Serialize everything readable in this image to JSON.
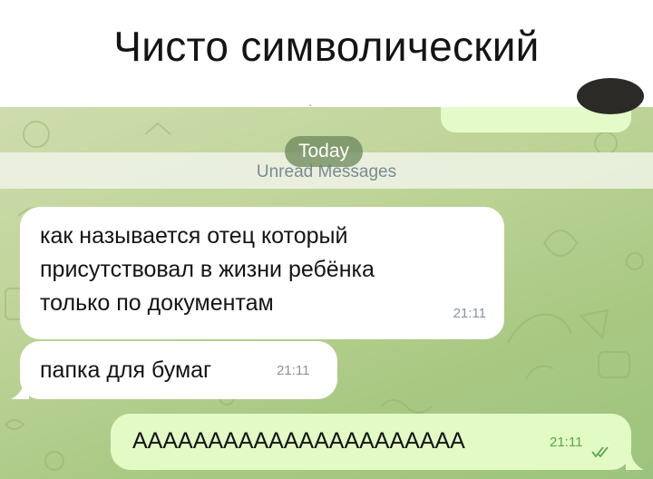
{
  "caption": {
    "text": "Чисто символический"
  },
  "header": {
    "typing_fragment": "."
  },
  "date_divider": {
    "label": "Today"
  },
  "unread_bar": {
    "label": "Unread Messages"
  },
  "messages": [
    {
      "direction": "incoming",
      "lines": [
        "как называется отец который",
        "присутствовал в жизни ребёнка",
        "только по документам"
      ],
      "time": "21:11"
    },
    {
      "direction": "incoming",
      "text": "папка для бумаг",
      "time": "21:11"
    },
    {
      "direction": "outgoing",
      "text": "АААААААААААААААААААААА",
      "time": "21:11",
      "status": "read"
    }
  ],
  "colors": {
    "wallpaper": "#b5cf8e",
    "incoming_bubble": "#ffffff",
    "outgoing_bubble": "#e2fbc5",
    "read_checks": "#5aa64b",
    "date_pill": "#708a5f"
  }
}
